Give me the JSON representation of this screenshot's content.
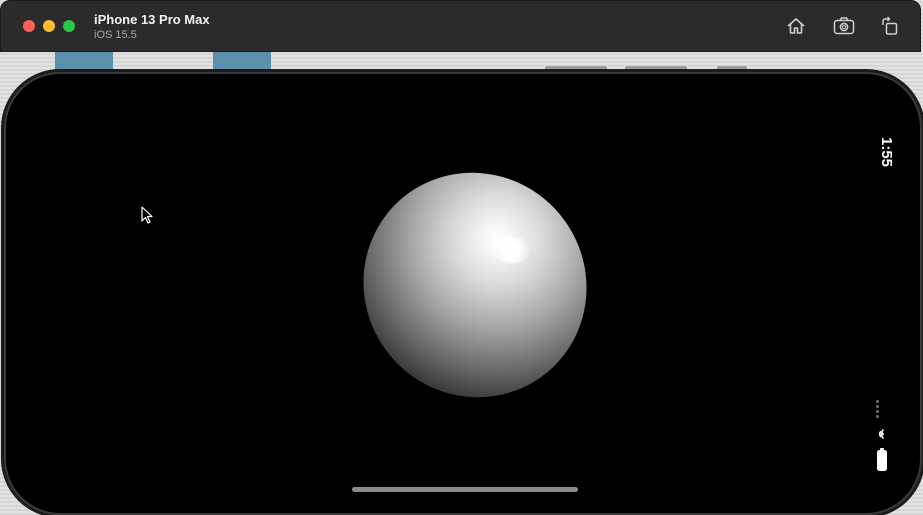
{
  "window": {
    "device_name": "iPhone 13 Pro Max",
    "os_version": "iOS 15.5",
    "toolbar": {
      "home_icon": "home-icon",
      "screenshot_icon": "camera-icon",
      "rotate_icon": "rotate-icon"
    }
  },
  "status_bar": {
    "time": "1:55",
    "wifi_icon": "wifi-icon",
    "battery_icon": "battery-icon",
    "signal_icon": "cellular-signal-icon"
  },
  "colors": {
    "titlebar": "#2b2b2b",
    "close": "#ff5f57",
    "minimize": "#febc2e",
    "maximize": "#28c840",
    "screen": "#000000"
  }
}
